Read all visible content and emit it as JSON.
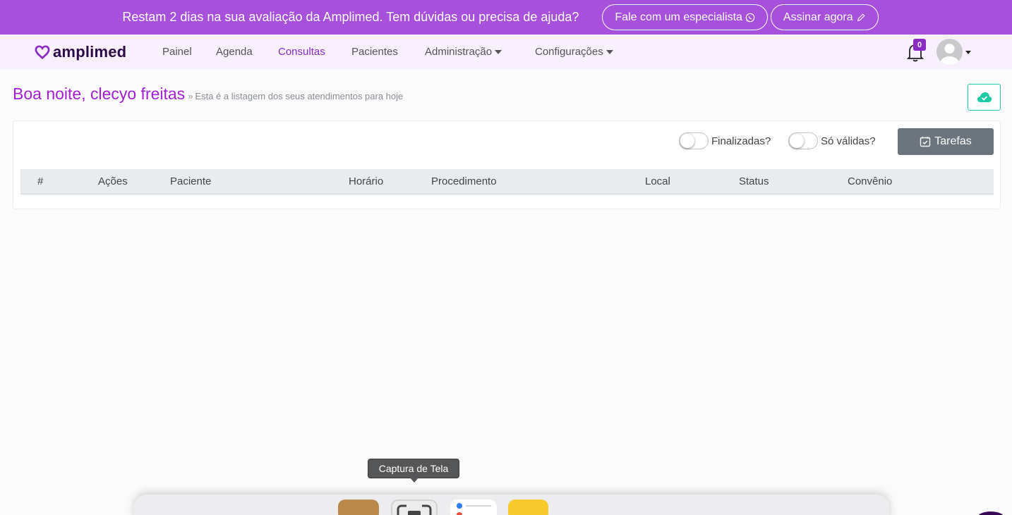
{
  "banner": {
    "text": "Restam 2 dias na sua avaliação da Amplimed. Tem dúvidas ou precisa de ajuda?",
    "specialist_label": "Fale com um especialista",
    "subscribe_label": "Assinar agora",
    "color": "#a650dc"
  },
  "nav": {
    "brand": "amplimed",
    "items": [
      {
        "label": "Painel"
      },
      {
        "label": "Agenda"
      },
      {
        "label": "Consultas"
      },
      {
        "label": "Pacientes"
      },
      {
        "label": "Administração"
      },
      {
        "label": "Configurações"
      }
    ],
    "active": "Consultas",
    "notification_count": "0",
    "accent": "#8a2bc4"
  },
  "page": {
    "greeting": "Boa noite, clecyo freitas",
    "subtitle": "Esta é a listagem dos seus atendimentos para hoje",
    "cloud_icon": "cloud-check-icon"
  },
  "filters": {
    "finalizadas_label": "Finalizadas?",
    "validas_label": "Só válidas?",
    "tarefas_label": "Tarefas"
  },
  "table": {
    "columns": [
      "#",
      "Ações",
      "Paciente",
      "Horário",
      "Procedimento",
      "Local",
      "Status",
      "Convênio"
    ],
    "rows": []
  },
  "dock": {
    "tooltip": "Captura de Tela"
  }
}
